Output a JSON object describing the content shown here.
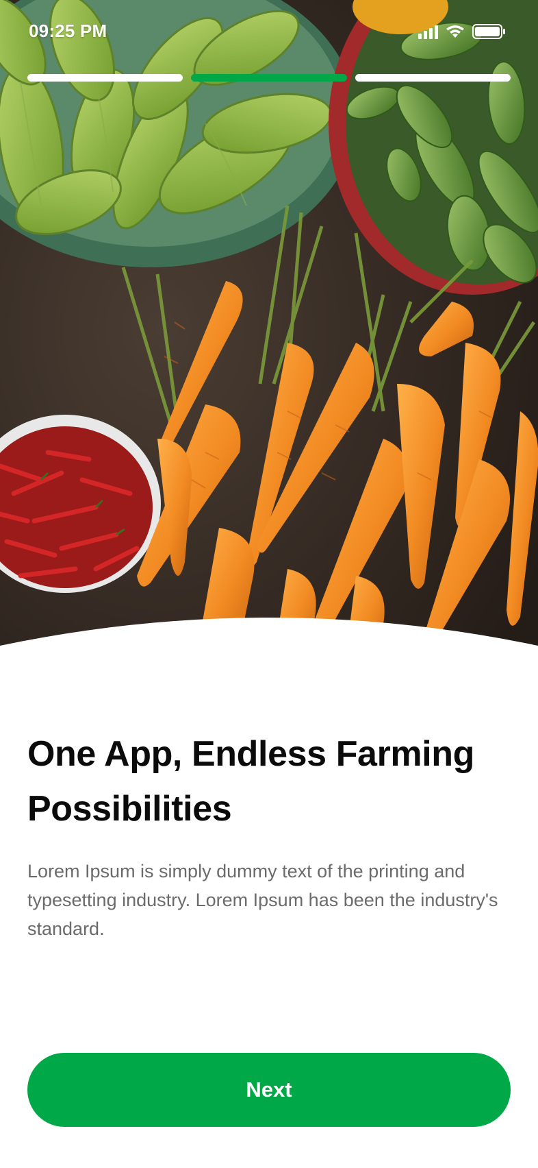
{
  "status_bar": {
    "time": "09:25 PM",
    "signal_icon": "cellular-signal-icon",
    "wifi_icon": "wifi-icon",
    "battery_icon": "battery-icon"
  },
  "hero": {
    "image": "photo of fresh vegetables: bitter gourds, cucumbers, carrots and red chillies",
    "colors": {
      "carrot": "#f08a24",
      "gourd": "#8bb33a",
      "cucumber": "#5d8f2e",
      "chilli": "#c81e1e",
      "ground": "#3a302a"
    }
  },
  "onboarding": {
    "page_count": 3,
    "current_page": 2,
    "title": "One App, Endless Farming Possibilities",
    "description": "Lorem Ipsum is simply dummy text of the printing and typesetting industry. Lorem Ipsum has been the industry's standard."
  },
  "actions": {
    "next_label": "Next"
  },
  "theme": {
    "accent": "#00a847",
    "title_color": "#0b0b0b",
    "body_color": "#6b6b6b"
  }
}
